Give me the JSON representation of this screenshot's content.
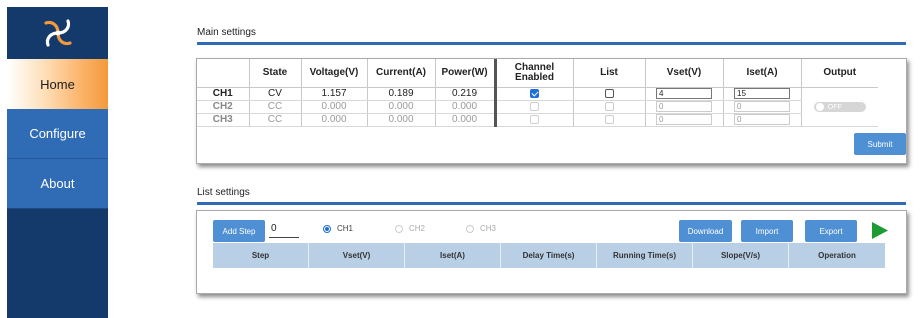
{
  "sidebar": {
    "items": [
      {
        "label": "Home"
      },
      {
        "label": "Configure"
      },
      {
        "label": "About"
      }
    ]
  },
  "main_settings": {
    "title": "Main settings",
    "headers": {
      "state": "State",
      "voltage": "Voltage(V)",
      "current": "Current(A)",
      "power": "Power(W)",
      "channel_enabled": "Channel\nEnabled",
      "list": "List",
      "vset": "Vset(V)",
      "iset": "Iset(A)",
      "output": "Output"
    },
    "rows": [
      {
        "ch": "CH1",
        "state": "CV",
        "voltage": "1.157",
        "current": "0.189",
        "power": "0.219",
        "enabled": true,
        "list": false,
        "vset": "4",
        "iset": "15"
      },
      {
        "ch": "CH2",
        "state": "CC",
        "voltage": "0.000",
        "current": "0.000",
        "power": "0.000",
        "enabled": false,
        "list": false,
        "vset": "0",
        "iset": "0"
      },
      {
        "ch": "CH3",
        "state": "CC",
        "voltage": "0.000",
        "current": "0.000",
        "power": "0.000",
        "enabled": false,
        "list": false,
        "vset": "0",
        "iset": "0"
      }
    ],
    "output_toggle": "OFF",
    "submit_label": "Submit"
  },
  "list_settings": {
    "title": "List settings",
    "add_step_label": "Add Step",
    "step_input_value": "0",
    "channels": [
      {
        "label": "CH1",
        "selected": true
      },
      {
        "label": "CH2",
        "selected": false
      },
      {
        "label": "CH3",
        "selected": false
      }
    ],
    "download_label": "Download",
    "import_label": "Import",
    "export_label": "Export",
    "columns": [
      "Step",
      "Vset(V)",
      "Iset(A)",
      "Delay Time(s)",
      "Running Time(s)",
      "Slope(V/s)",
      "Operation"
    ]
  },
  "colors": {
    "sidebar": "#14396b",
    "nav_button": "#2f6cb5",
    "accent_orange": "#f39a3a",
    "button_blue": "#4f8fd3",
    "play_green": "#1e9b33"
  }
}
